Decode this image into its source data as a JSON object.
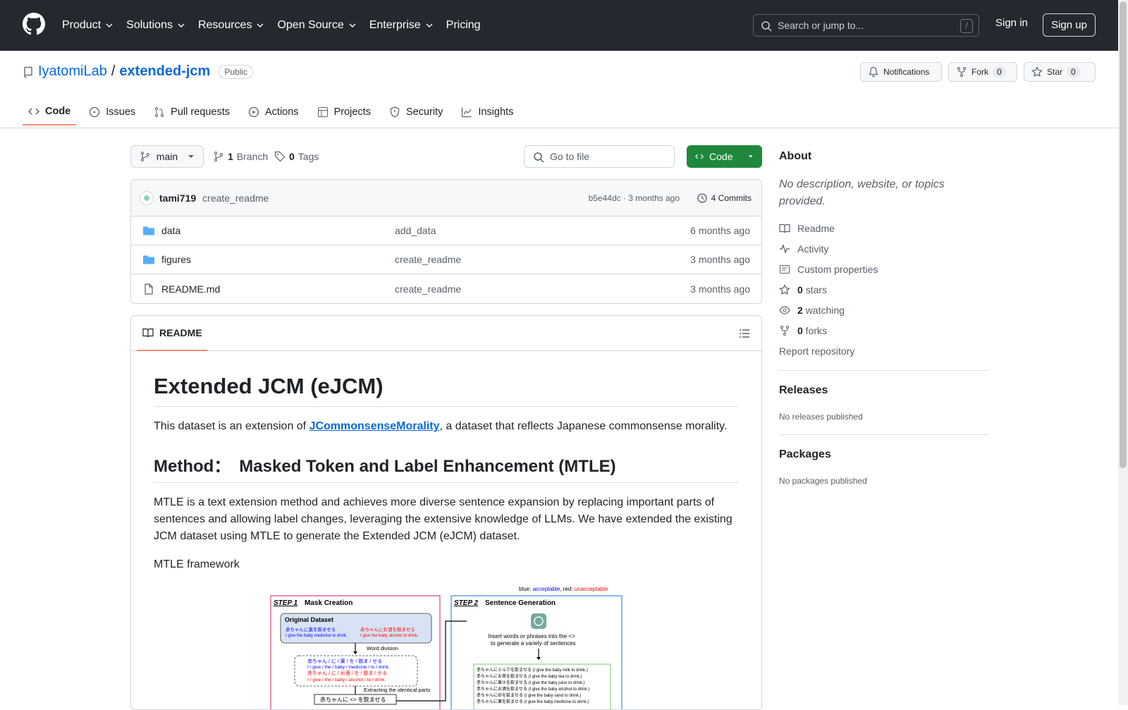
{
  "header": {
    "nav": [
      "Product",
      "Solutions",
      "Resources",
      "Open Source",
      "Enterprise",
      "Pricing"
    ],
    "search_placeholder": "Search or jump to...",
    "search_shortcut": "/",
    "signin": "Sign in",
    "signup": "Sign up"
  },
  "repo": {
    "owner": "IyatomiLab",
    "sep": "/",
    "name": "extended-jcm",
    "visibility": "Public",
    "notifications": "Notifications",
    "fork": "Fork",
    "fork_count": "0",
    "star": "Star",
    "star_count": "0"
  },
  "tabs": [
    "Code",
    "Issues",
    "Pull requests",
    "Actions",
    "Projects",
    "Security",
    "Insights"
  ],
  "branch": {
    "name": "main",
    "branch_count": "1",
    "branch_label": "Branch",
    "tag_count": "0",
    "tag_label": "Tags",
    "goto_placeholder": "Go to file",
    "code_button": "Code"
  },
  "commit": {
    "author": "tami719",
    "message": "create_readme",
    "sha_time": "b5e44dc · 3 months ago",
    "commits": "4 Commits"
  },
  "files": [
    {
      "name": "data",
      "type": "folder",
      "message": "add_data",
      "date": "6 months ago"
    },
    {
      "name": "figures",
      "type": "folder",
      "message": "create_readme",
      "date": "3 months ago"
    },
    {
      "name": "README.md",
      "type": "file",
      "message": "create_readme",
      "date": "3 months ago"
    }
  ],
  "readme": {
    "tab": "README",
    "h1": "Extended JCM (eJCM)",
    "p1_pre": "This dataset is an extension of ",
    "p1_link": "JCommonsenseMorality",
    "p1_post": ", a dataset that reflects Japanese commonsense morality.",
    "h2": "Method：　Masked Token and Label Enhancement (MTLE)",
    "p2": "MTLE is a text extension method and achieves more diverse sentence expansion by replacing important parts of sentences and allowing label changes, leveraging the extensive knowledge of LLMs. We have extended the existing JCM dataset using MTLE to generate the Extended JCM (eJCM) dataset.",
    "p3": "MTLE framework",
    "figure": {
      "legend_blue": "blue: ",
      "legend_acc": "acceptable",
      "legend_sep": ", red: ",
      "legend_unacc": "unacceptable",
      "step1": "STEP 1",
      "step1_title": "Mask Creation",
      "step2": "STEP 2",
      "step2_title": "Sentence Generation",
      "orig": "Original Dataset",
      "orig_jp1": "赤ちゃんに薬を飲ませる",
      "orig_en1": "I give the baby medicine to drink.",
      "orig_jp2": "赤ちゃんにお酒を飲ませる",
      "orig_en2": "I give the baby alcohol to drink.",
      "word_div": "Word division",
      "div1_jp": "赤ちゃん / に / 薬 / を / 飲ま / せる",
      "div1_en": "I / give / the / baby / medicine / to / drink.",
      "div2_jp": "赤ちゃん / に / お酒 / を / 飲ま / せる",
      "div2_en": "I / give / the / baby / alcohol / to / drink.",
      "extract": "Extracting the identical parts",
      "mask": "赤ちゃんに <> を飲ませる",
      "insert1": "Insert words or phrases into the <>",
      "insert2": "to generate a variety of sentences",
      "gen": [
        "赤ちゃんにミルクを飲ませる (I give the baby milk to drink.)",
        "赤ちゃんにお茶を飲ませる (I give the baby tea to drink.)",
        "赤ちゃんに果汁を飲ませる (I give the baby juice to drink.)",
        "赤ちゃんにお酒を飲ませる (I give the baby alcohol to drink.)",
        "赤ちゃんに砂を飲ませる (I give the baby sand to drink.)",
        "赤ちゃんに薬を飲ませる (I give the baby medicine to drink.)"
      ]
    }
  },
  "sidebar": {
    "about": "About",
    "desc": "No description, website, or topics provided.",
    "items": [
      {
        "icon": "book-icon",
        "label": "Readme",
        "count": ""
      },
      {
        "icon": "pulse-icon",
        "label": "Activity",
        "count": ""
      },
      {
        "icon": "note-icon",
        "label": "Custom properties",
        "count": ""
      },
      {
        "icon": "star-icon",
        "label": " stars",
        "count": "0"
      },
      {
        "icon": "eye-icon",
        "label": " watching",
        "count": "2"
      },
      {
        "icon": "fork-icon",
        "label": " forks",
        "count": "0"
      }
    ],
    "report": "Report repository",
    "releases": "Releases",
    "releases_sub": "No releases published",
    "packages": "Packages",
    "packages_sub": "No packages published"
  }
}
